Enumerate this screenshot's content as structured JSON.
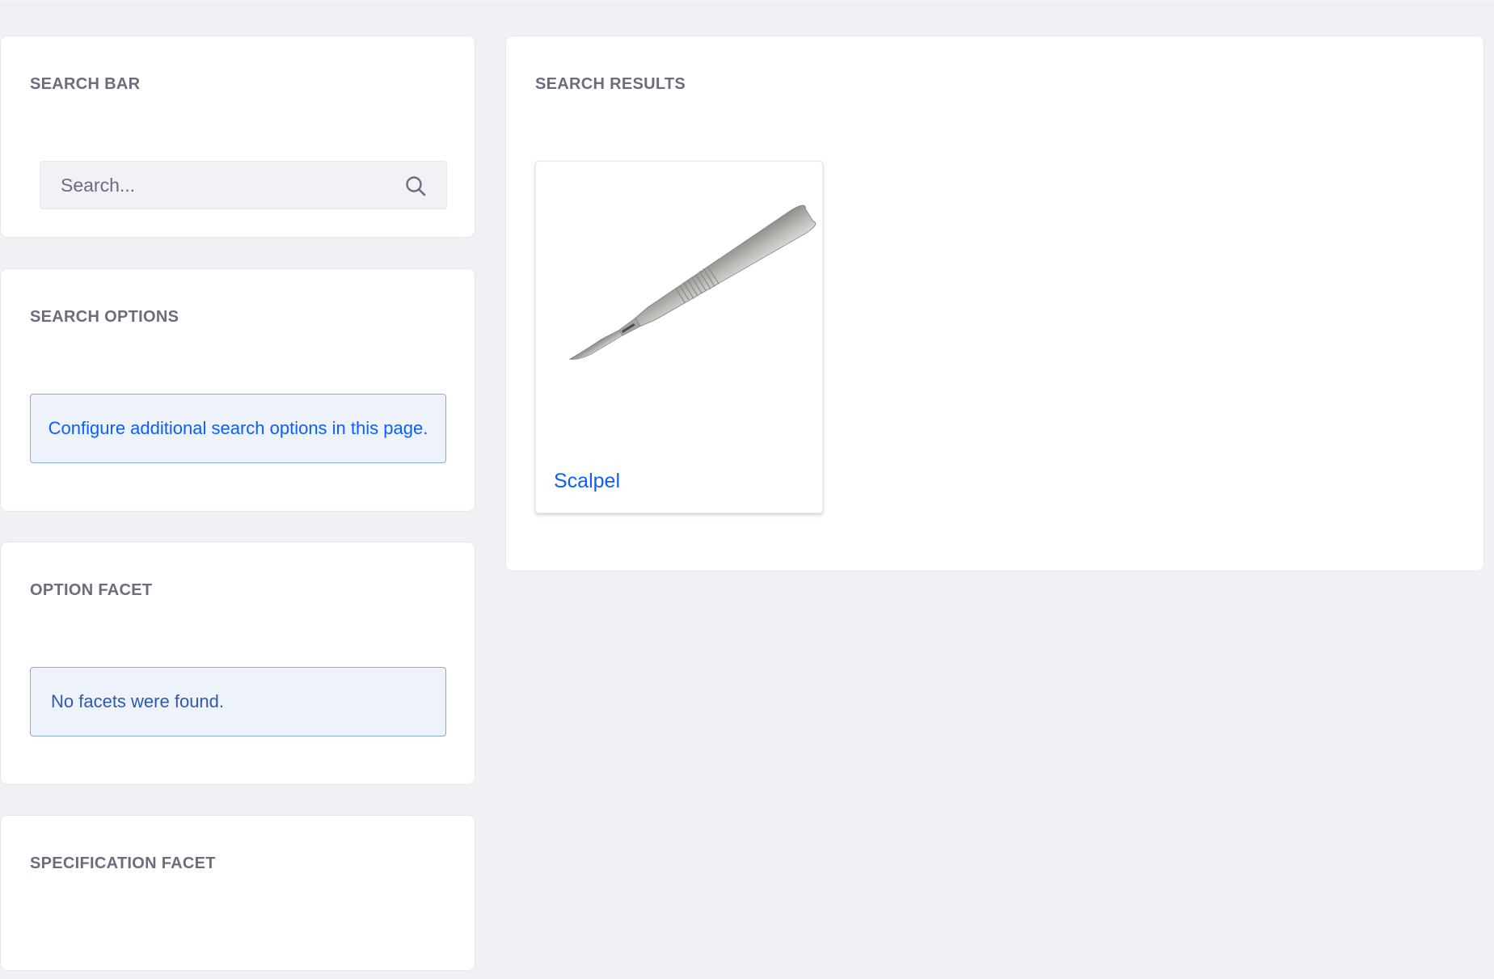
{
  "search_bar": {
    "title": "SEARCH BAR",
    "placeholder": "Search...",
    "icon": "search-icon"
  },
  "search_options": {
    "title": "SEARCH OPTIONS",
    "link_text": "Configure additional search options in this page."
  },
  "option_facet": {
    "title": "OPTION FACET",
    "empty_message": "No facets were found."
  },
  "specification_facet": {
    "title": "SPECIFICATION FACET"
  },
  "search_results": {
    "title": "SEARCH RESULTS",
    "items": [
      {
        "name": "Scalpel",
        "image": "scalpel-image"
      }
    ]
  },
  "colors": {
    "page_background": "#f0f1f5",
    "heading": "#6b6c7e",
    "link": "#0b5fff",
    "info_background": "#eef2fa",
    "info_border": "#89a7e0",
    "info_text": "#2e5aac"
  }
}
